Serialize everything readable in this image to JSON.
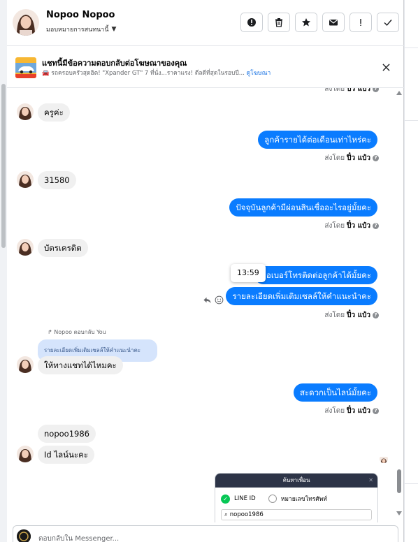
{
  "header": {
    "name": "Nopoo Nopoo",
    "subtitle": "มอบหมายการสนทนานี้",
    "actions": [
      "alert-circle-icon",
      "trash-icon",
      "star-icon",
      "mail-icon",
      "exclamation-icon",
      "check-icon"
    ]
  },
  "ad": {
    "title": "แชทนี้มีข้อความตอบกลับต่อโฆษณาของคุณ",
    "text": "🚘 รถครอบครัวสุดฮิต! \"Xpander GT\" 7 ที่นั่ง...ราคาแรง! ดีลดีที่สุดในรอบปี...",
    "link": "ดูโฆษณา"
  },
  "messages": {
    "top_sent_by": "ส่งโดย",
    "top_sender": "ปิ๋ว แป๋ว",
    "in_1": "ครูค่ะ",
    "out_1": "ลูกค้ารายได้ต่อเดือนเท่าไหร่คะ",
    "sent_by_label": "ส่งโดย",
    "sender": "ปิ๋ว แป๋ว",
    "in_2": "31580",
    "out_2": "ปัจจุบันลูกค้ามีผ่อนสินเชื่ออะไรอยู่มั้ยคะ",
    "in_3": "บัตรเครดิต",
    "out_3": "ขอเบอร์โทรติดต่อลูกค้าได้มั้ยคะ",
    "tooltip_time": "13:59",
    "out_4": "รายละเอียดเพิ่มเติมเซลล์ให้คำแนะนำคะ",
    "replied_to": "Nopoo ตอบกลับ You",
    "quote": "รายละเอียดเพิ่มเติมเซลล์ให้คำแนะนำคะ",
    "in_4": "ให้ทางแชทได้ไหมคะ",
    "out_5": "สะดวกเป็นไลน์มั้ยคะ",
    "in_5": "nopoo1986",
    "in_6": "Id ไลน์นะคะ"
  },
  "line_card": {
    "title": "ค้นหาเพื่อน",
    "option_1": "LINE ID",
    "option_2": "หมายเลขโทรศัพท์",
    "search_value": "nopoo1986"
  },
  "composer": {
    "placeholder": "ตอบกลับใน Messenger..."
  },
  "colors": {
    "outgoing": "#0a7cff",
    "incoming": "#f0f0f0",
    "quote": "#d5e4fc"
  }
}
